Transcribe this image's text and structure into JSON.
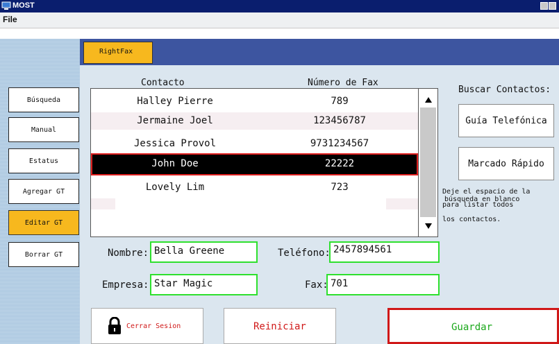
{
  "window": {
    "title": "MOST",
    "menu_file": "File"
  },
  "tab": {
    "label": "RightFax"
  },
  "sidebar": {
    "items": [
      {
        "label": "Búsqueda",
        "active": false
      },
      {
        "label": "Manual",
        "active": false
      },
      {
        "label": "Estatus",
        "active": false
      },
      {
        "label": "Agregar GT",
        "active": false
      },
      {
        "label": "Editar GT",
        "active": true
      },
      {
        "label": "Borrar GT",
        "active": false
      }
    ]
  },
  "contacts": {
    "col_contact": "Contacto",
    "col_fax": "Número de Fax",
    "rows": [
      {
        "name": "Halley Pierre",
        "fax": "789"
      },
      {
        "name": "Jermaine Joel",
        "fax": "123456787"
      },
      {
        "name": "Jessica Provol",
        "fax": "9731234567"
      },
      {
        "name": "John Doe",
        "fax": "22222",
        "selected": true
      },
      {
        "name": "Lovely Lim",
        "fax": "723"
      }
    ]
  },
  "form": {
    "nombre_label": "Nombre:",
    "nombre_value": "Bella Greene",
    "empresa_label": "Empresa:",
    "empresa_value": "Star Magic",
    "telefono_label": "Teléfono:",
    "telefono_value": "2457894561",
    "fax_label": "Fax:",
    "fax_value": "701"
  },
  "right": {
    "title": "Buscar Contactos:",
    "phonebook_button": "Guía Telefónica",
    "speed_dial_button": "Marcado Rápido",
    "hint_line1": "Deje el espacio de la",
    "hint_line2": "búsqueda en blanco",
    "hint_line3": "para listar todos",
    "hint_line4": "los contactos."
  },
  "actions": {
    "logout": "Cerrar Sesion",
    "reset": "Reiniciar",
    "save": "Guardar"
  },
  "colors": {
    "title_bar": "#0a1e6e",
    "accent": "#f7b81e",
    "field_border": "#2ee02e",
    "danger": "#d01818"
  },
  "icons": {
    "app": "monitor-icon",
    "logout": "lock-icon",
    "scroll_up": "triangle-up-icon",
    "scroll_down": "triangle-down-icon"
  }
}
